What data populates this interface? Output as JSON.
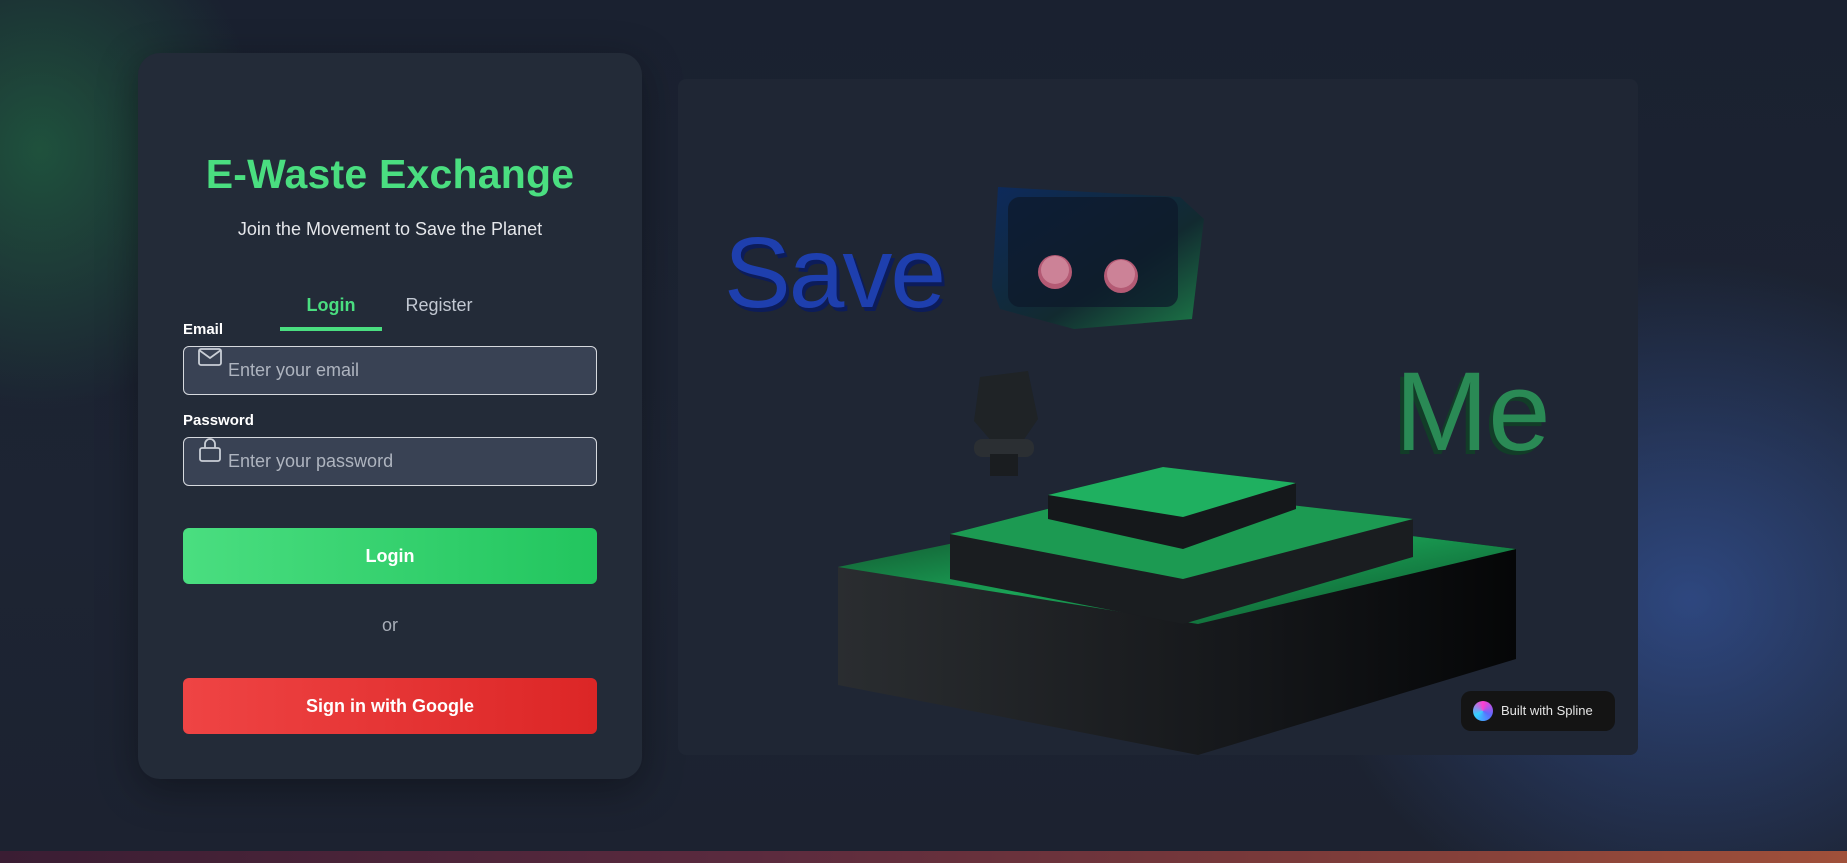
{
  "app": {
    "title": "E-Waste Exchange",
    "subtitle": "Join the Movement to Save the Planet"
  },
  "tabs": [
    {
      "label": "Login",
      "active": true
    },
    {
      "label": "Register",
      "active": false
    }
  ],
  "form": {
    "email": {
      "label": "Email",
      "placeholder": "Enter your email",
      "value": "",
      "icon": "mail-icon"
    },
    "password": {
      "label": "Password",
      "placeholder": "Enter your password",
      "value": "",
      "icon": "lock-icon"
    },
    "login_button": "Login",
    "divider_text": "or",
    "google_button": "Sign in with Google"
  },
  "scene": {
    "text_left": "Save",
    "text_right": "Me",
    "badge": "Built with Spline"
  },
  "colors": {
    "accent_green": "#4ade80",
    "danger_red": "#ef4444",
    "background": "#1b2230",
    "card": "#232b38"
  }
}
